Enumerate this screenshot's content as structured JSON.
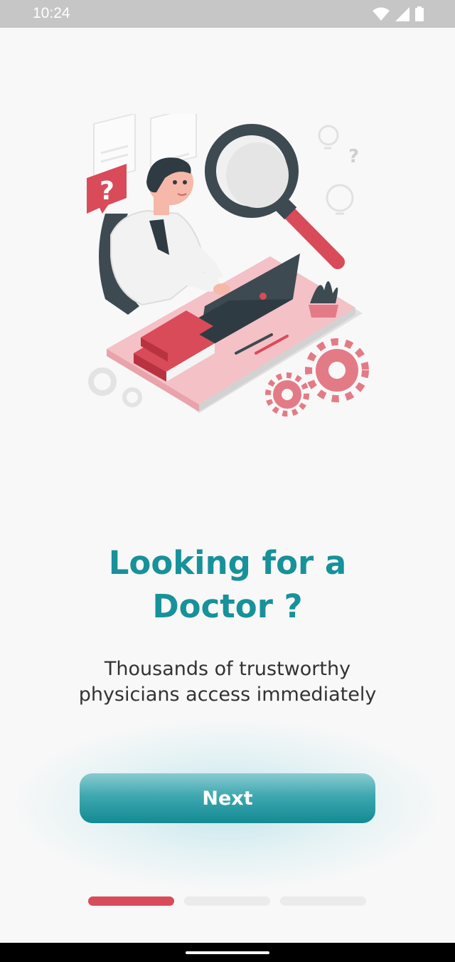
{
  "status_bar": {
    "time": "10:24",
    "icons": [
      "wifi-icon",
      "cell-signal-icon",
      "battery-icon"
    ]
  },
  "illustration": {
    "name": "doctor-at-laptop-illustration"
  },
  "onboarding": {
    "title_line1": "Looking for a",
    "title_line2": "Doctor ?",
    "subtitle_line1": "Thousands of trustworthy",
    "subtitle_line2": "physicians access immediately",
    "next_label": "Next"
  },
  "pager": {
    "pages": 3,
    "current": 1
  },
  "colors": {
    "accent": "#17919a",
    "button_top": "#8acbd1",
    "button_bottom": "#138a93",
    "pager_active": "#d94b59",
    "pager_inactive": "#ebebeb",
    "background": "#f8f8f8"
  }
}
